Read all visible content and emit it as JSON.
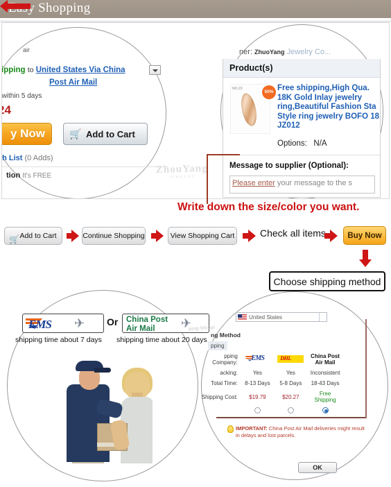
{
  "header": {
    "title": "Easy Shopping"
  },
  "product_page": {
    "air_fragment": "air",
    "shipping_label_green": "hipping",
    "shipping_to": "to",
    "shipping_option_line1": "United States Via China",
    "shipping_option_line2": "Post Air Mail",
    "dispatch_note": "t within 5 days",
    "price_fragment": "24",
    "buy_now_label": "y Now",
    "add_to_cart_label": "Add to Cart",
    "cart_icon": "shopping-cart-icon",
    "wish_list_label": "sh List",
    "wish_list_count": "(0 Adds)",
    "protection_label": "tion",
    "protection_value": "It's FREE",
    "dropdown_icon": "chevron-down-icon"
  },
  "order_review": {
    "seller_prefix": "ner:",
    "seller_name": "ZhuoYang",
    "seller_suffix": "Jewelry Co...",
    "products_header": "Product(s)",
    "thumb_code": "NO.23",
    "badge_text": "50%",
    "product_title": "Free shipping,High Qua. 18K Gold Inlay jewelry ring,Beautiful Fashion Sta Style ring jewelry BOFO 18 JZ012",
    "options_label": "Options:",
    "options_value": "N/A",
    "message_label": "Message to supplier (Optional):",
    "message_placeholder_underlined": "Please enter",
    "message_placeholder_rest": " your message to the s"
  },
  "watermark": {
    "text": "ZhouYang",
    "sub": "JEWELRY"
  },
  "callout": {
    "text": "Write down the size/color you want."
  },
  "steps": {
    "add_to_cart": "Add to Cart",
    "cart_icon": "shopping-cart-icon",
    "continue_shopping": "Continue Shopping",
    "view_shopping_cart": "View Shopping Cart",
    "check_all_items": "Check all items",
    "buy_now": "Buy Now",
    "arrow_icon": "right-arrow-icon",
    "down_arrow_icon": "down-arrow-icon"
  },
  "choose_shipping": {
    "label": "Choose shipping method",
    "left_arrow_icon": "left-arrow-icon"
  },
  "carriers": {
    "ems_name": "EMS",
    "or": "Or",
    "china_post_line1": "China Post",
    "china_post_line2": "Air Mail",
    "plane_icon": "airplane-icon",
    "ems_caption": "shipping time about 7 days",
    "china_post_caption": "shipping time about 20 days"
  },
  "photo": {
    "alt": "courier-handing-package-to-customer"
  },
  "shipping_dialog": {
    "country_value": "United States",
    "flag_icon": "us-flag-icon",
    "dropdown_icon": "chevron-down-icon",
    "title": "ng Method",
    "tab": "pping",
    "rows": [
      {
        "label": "pping Company:",
        "values": [
          "EMS",
          "DHL",
          "China Post Air Mail",
          ""
        ]
      },
      {
        "label": "acking:",
        "values": [
          "Yes",
          "Yes",
          "Inconsistent",
          ""
        ]
      },
      {
        "label": "Total Time:",
        "values": [
          "8-13 Days",
          "5-8 Days",
          "18-43 Days",
          ""
        ]
      },
      {
        "label": "Shipping Cost:",
        "values": [
          "$19.79",
          "$20.27",
          "Free Shipping",
          ""
        ]
      }
    ],
    "china_post_name_l1": "China Post",
    "china_post_name_l2": "Air Mail",
    "free_l1": "Free",
    "free_l2": "Shipping",
    "radio_selected_index": 2,
    "notice_bold": "IMPORTANT:",
    "notice_text": " China Post Air Mail deliveries might result in delays and lost parcels.",
    "bulb_icon": "lightbulb-icon",
    "ok_label": "OK"
  },
  "bottom_watermark": {
    "text": "ping Shippi"
  },
  "colors": {
    "header_bg": "#a1968a",
    "accent_red": "#cf1616",
    "callout_red": "#cc1111",
    "link_blue": "#1f5fb5",
    "buy_orange": "#f5a318",
    "free_green": "#1a8a1a",
    "price_red": "#a3232b"
  }
}
